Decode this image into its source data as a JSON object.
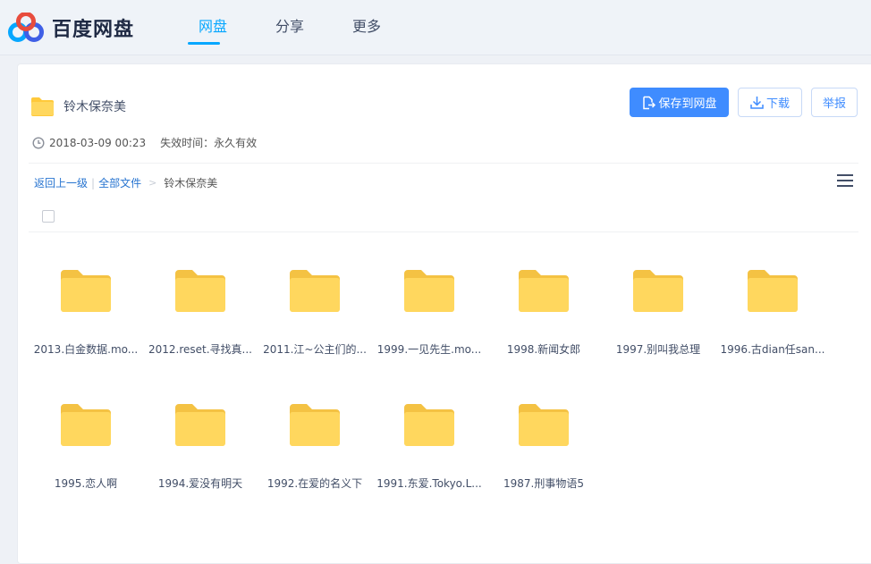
{
  "app": {
    "logo_text": "百度网盘",
    "nav": [
      {
        "label": "网盘",
        "active": true
      },
      {
        "label": "分享",
        "active": false
      },
      {
        "label": "更多",
        "active": false
      }
    ]
  },
  "share": {
    "title": "铃木保奈美",
    "icon": "folder-icon",
    "created": "2018-03-09 00:23",
    "expire": "失效时间：永久有效",
    "buttons": {
      "save": "保存到网盘",
      "download": "下载",
      "report": "举报"
    }
  },
  "breadcrumb": {
    "back": "返回上一级",
    "separator": "|",
    "all_files": "全部文件",
    "arrow": ">",
    "current": "铃木保奈美"
  },
  "files": [
    {
      "name": "2013.白金数据.mo..."
    },
    {
      "name": "2012.reset.寻找真..."
    },
    {
      "name": "2011.江~公主们的..."
    },
    {
      "name": "1999.一见先生.mo..."
    },
    {
      "name": "1998.新闻女郎"
    },
    {
      "name": "1997.别叫我总理"
    },
    {
      "name": "1996.古dian任san..."
    },
    {
      "name": "1995.恋人啊"
    },
    {
      "name": "1994.爱没有明天"
    },
    {
      "name": "1992.在爱的名义下"
    },
    {
      "name": "1991.东爱.Tokyo.L..."
    },
    {
      "name": "1987.刑事物语5"
    }
  ],
  "colors": {
    "accent": "#06a7ff",
    "button_primary": "#3f8cff",
    "folder": "#ffd75e"
  }
}
